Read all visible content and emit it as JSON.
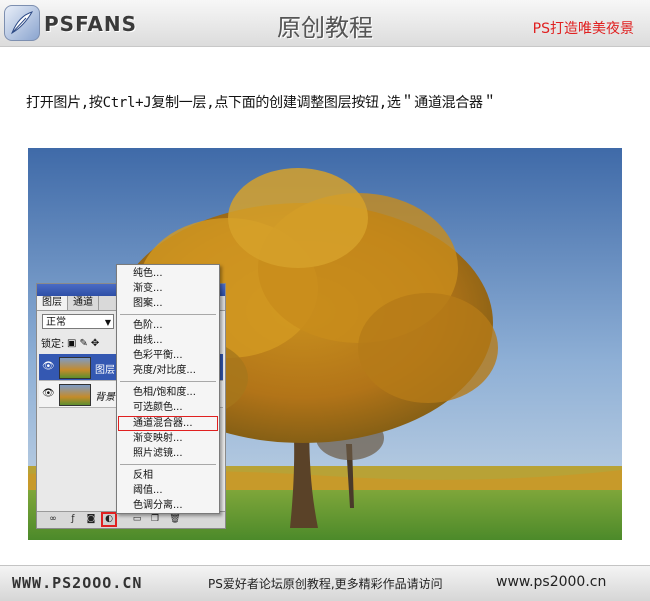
{
  "header": {
    "brand": "PSFANS",
    "title": "原创教程",
    "subtitle": "PS打造唯美夜景"
  },
  "instruction": "打开图片,按Ctrl+J复制一层,点下面的创建调整图层按钮,选＂通道混合器＂",
  "layers_panel": {
    "tabs": [
      "图层",
      "通道"
    ],
    "blend_mode": "正常",
    "lock_label": "锁定:",
    "layers": [
      {
        "name": "图层",
        "selected": true
      },
      {
        "name": "背景",
        "selected": false
      }
    ]
  },
  "adjustment_menu": {
    "groups": [
      [
        "纯色...",
        "渐变...",
        "图案..."
      ],
      [
        "色阶...",
        "曲线...",
        "色彩平衡...",
        "亮度/对比度..."
      ],
      [
        "色相/饱和度...",
        "可选颜色...",
        "通道混合器...",
        "渐变映射...",
        "照片滤镜..."
      ],
      [
        "反相",
        "阈值...",
        "色调分离..."
      ]
    ],
    "highlighted": "通道混合器..."
  },
  "footer": {
    "left": "WWW.PS2OOO.CN",
    "middle": "PS爱好者论坛原创教程,更多精彩作品请访问",
    "right": "www.ps2000.cn"
  },
  "colors": {
    "accent_red": "#e02020",
    "selection_blue": "#3458b2"
  }
}
